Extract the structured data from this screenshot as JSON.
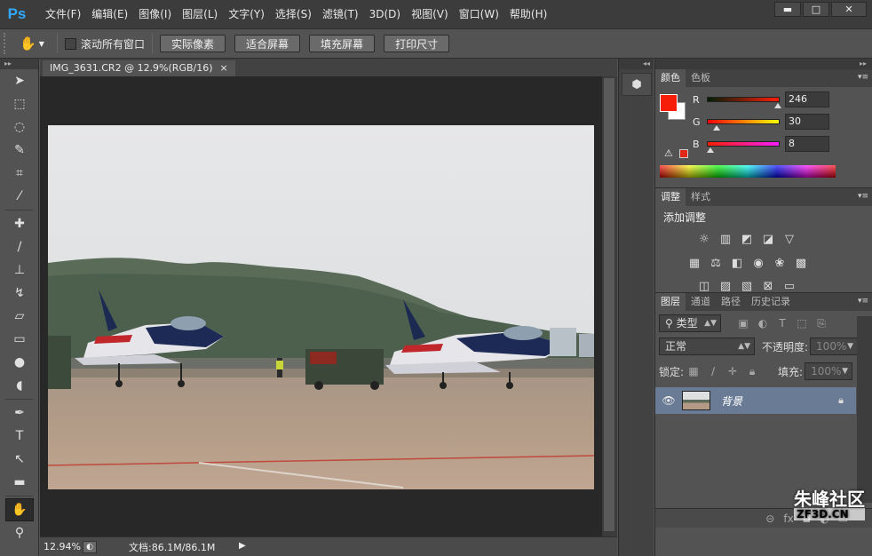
{
  "app": {
    "logo": "Ps"
  },
  "menu": [
    "文件(F)",
    "编辑(E)",
    "图像(I)",
    "图层(L)",
    "文字(Y)",
    "选择(S)",
    "滤镜(T)",
    "3D(D)",
    "视图(V)",
    "窗口(W)",
    "帮助(H)"
  ],
  "window_controls": {
    "minimize": "▬",
    "maximize": "□",
    "close": "✕"
  },
  "options": {
    "tool_icon": "hand-icon",
    "scroll_all_windows": "滚动所有窗口",
    "scroll_all_checked": false,
    "buttons": [
      "实际像素",
      "适合屏幕",
      "填充屏幕",
      "打印尺寸"
    ]
  },
  "document": {
    "tab_title": "IMG_3631.CR2 @ 12.9%(RGB/16)",
    "tab_close": "×",
    "zoom": "12.94%",
    "doc_info": "文档:86.1M/86.1M"
  },
  "color_panel": {
    "tabs": [
      "颜色",
      "色板"
    ],
    "active_tab": 0,
    "foreground": "#f61e08",
    "background": "#ffffff",
    "r_label": "R",
    "g_label": "G",
    "b_label": "B",
    "r": 246,
    "g": 30,
    "b": 8,
    "warning_icon": "gamut-warning-icon"
  },
  "adjustments_panel": {
    "tabs": [
      "调整",
      "样式"
    ],
    "active_tab": 0,
    "title": "添加调整",
    "icons_row1": [
      "brightness-icon",
      "levels-icon",
      "curves-icon",
      "exposure-icon",
      "vibrance-icon"
    ],
    "icons_row2": [
      "hue-saturation-icon",
      "color-balance-icon",
      "black-white-icon",
      "photo-filter-icon",
      "channel-mixer-icon",
      "color-lookup-icon"
    ],
    "icons_row3": [
      "invert-icon",
      "posterize-icon",
      "threshold-icon",
      "selective-color-icon",
      "gradient-map-icon"
    ]
  },
  "layers_panel": {
    "tabs": [
      "图层",
      "通道",
      "路径",
      "历史记录"
    ],
    "active_tab": 0,
    "filter_kind": "类型",
    "blend_mode": "正常",
    "opacity_label": "不透明度:",
    "opacity_value": "100%",
    "lock_label": "锁定:",
    "fill_label": "填充:",
    "fill_value": "100%",
    "layers": [
      {
        "name": "背景",
        "visible": true,
        "locked": true
      }
    ]
  },
  "watermark": {
    "main": "朱峰社区",
    "sub": "ZF3D.CN"
  }
}
